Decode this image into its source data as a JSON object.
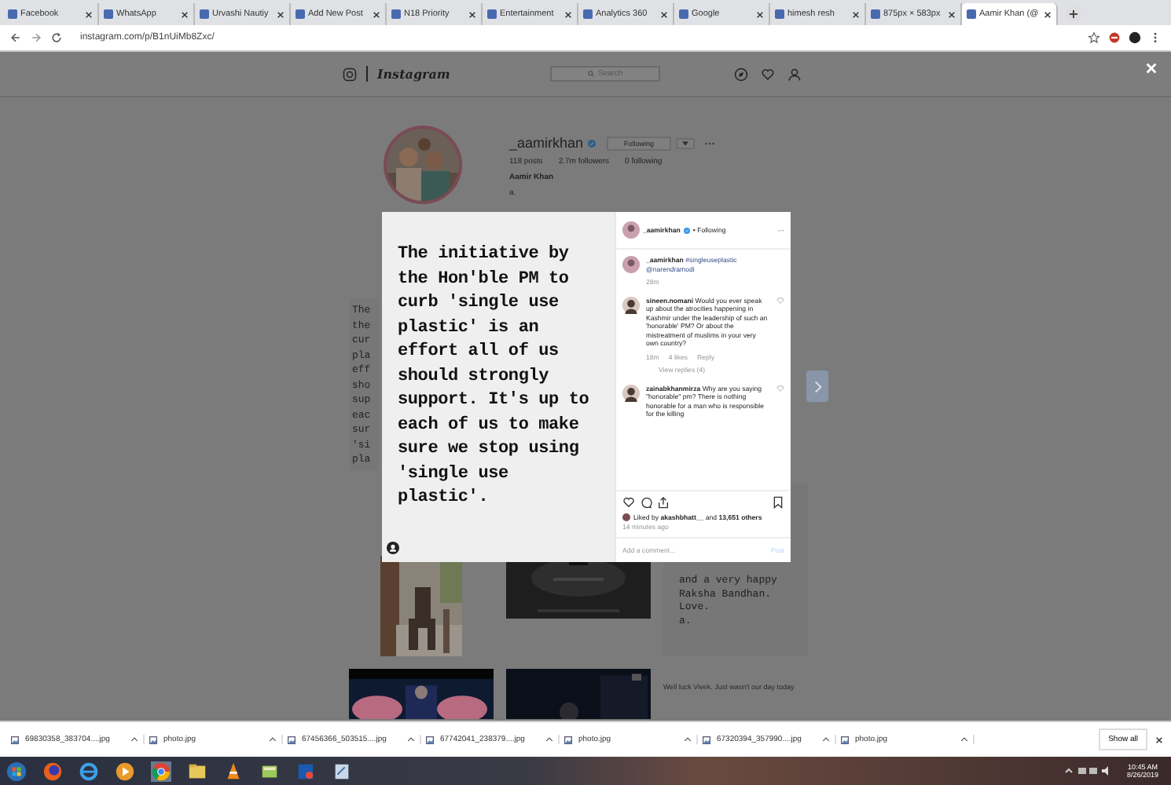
{
  "browser": {
    "tabs": [
      {
        "title": "Facebook",
        "selected": false
      },
      {
        "title": "WhatsApp",
        "selected": false
      },
      {
        "title": "Urvashi Nautiy",
        "selected": false
      },
      {
        "title": "Add New Post",
        "selected": false
      },
      {
        "title": "N18 Priority",
        "selected": false
      },
      {
        "title": "Entertainment",
        "selected": false
      },
      {
        "title": "Analytics 360",
        "selected": false
      },
      {
        "title": "Google",
        "selected": false
      },
      {
        "title": "himesh resh",
        "selected": false
      },
      {
        "title": "875px × 583px",
        "selected": false
      },
      {
        "title": "Aamir Khan (@",
        "selected": true
      }
    ],
    "url": "instagram.com/p/B1nUiMb8Zxc/"
  },
  "instagram": {
    "logo": "Instagram",
    "search_placeholder": "Search",
    "profile": {
      "username": "_aamirkhan",
      "follow_button": "Following",
      "stats": [
        "118 posts",
        "2.7m followers",
        "0 following"
      ],
      "name": "Aamir Khan",
      "bio": "a."
    },
    "left_fragment": [
      "The",
      "the",
      "cur",
      "pla",
      "eff",
      "sho",
      "sup",
      "eac",
      "sur",
      "'si",
      "pla"
    ],
    "right_card": [
      "and a very happy",
      "Raksha Bandhan.",
      "Love.",
      "a."
    ],
    "bottom_card": "Well luck Vivek. Just wasn't our day today"
  },
  "modal": {
    "post_text": "The initiative by the Hon'ble PM to curb 'single use plastic' is an effort all of us should strongly support. It's up to each of us to make sure we stop using 'single use plastic'.",
    "header": {
      "username": "_aamirkhan",
      "following": "• Following",
      "more": "···"
    },
    "caption": {
      "username": "_aamirkhan",
      "text": "#singleuseplastic @narendramodi",
      "time": "28m"
    },
    "comments": [
      {
        "username": "sineen.nomani",
        "text": "Would you ever speak up about the atrocities happening in Kashmir under the leadership of such an 'honorable' PM? Or about the mistreatment of muslims in your very own country?",
        "time": "18m",
        "likes": "4 likes",
        "reply": "Reply",
        "view_replies": "View replies (4)"
      },
      {
        "username": "zainabkhanmirza",
        "text": "Why are you saying \"honorable\" pm? There is nothing honorable for a man who is responsible for the killing"
      }
    ],
    "likes": "Liked by **akashbhatt__** and **13,651 others**",
    "time_ago": "14 minutes ago",
    "comment_placeholder": "Add a comment...",
    "post_button": "Post"
  },
  "downloads": {
    "files": [
      "69830358_383704....jpg",
      "photo.jpg",
      "67456366_503515....jpg",
      "67742041_238379....jpg",
      "photo.jpg",
      "67320394_357990....jpg",
      "photo.jpg"
    ],
    "show_all": "Show all"
  },
  "taskbar": {
    "time": "10:45 AM",
    "date": "8/26/2019"
  }
}
